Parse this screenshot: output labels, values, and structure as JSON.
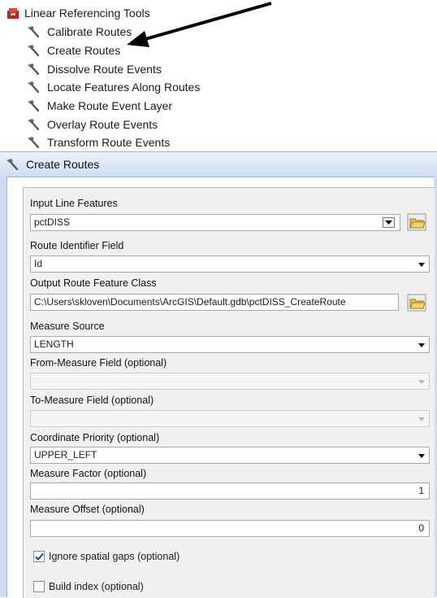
{
  "toolbox": {
    "name": "Linear Referencing Tools",
    "tools": [
      "Calibrate Routes",
      "Create Routes",
      "Dissolve Route Events",
      "Locate Features Along Routes",
      "Make Route Event Layer",
      "Overlay Route Events",
      "Transform Route Events"
    ]
  },
  "dialog": {
    "title": "Create Routes",
    "input_line_features": {
      "label": "Input Line Features",
      "value": "pctDISS"
    },
    "route_identifier_field": {
      "label": "Route Identifier Field",
      "value": "Id"
    },
    "output_route_feature_class": {
      "label": "Output Route Feature Class",
      "value": "C:\\Users\\skloven\\Documents\\ArcGIS\\Default.gdb\\pctDISS_CreateRoute"
    },
    "measure_source": {
      "label": "Measure Source",
      "value": "LENGTH"
    },
    "from_measure_field": {
      "label": "From-Measure Field (optional)",
      "value": ""
    },
    "to_measure_field": {
      "label": "To-Measure Field (optional)",
      "value": ""
    },
    "coordinate_priority": {
      "label": "Coordinate Priority (optional)",
      "value": "UPPER_LEFT"
    },
    "measure_factor": {
      "label": "Measure Factor (optional)",
      "value": "1"
    },
    "measure_offset": {
      "label": "Measure Offset (optional)",
      "value": "0"
    },
    "ignore_spatial_gaps": {
      "label": "Ignore spatial gaps (optional)",
      "checked": true
    },
    "build_index": {
      "label": "Build index (optional)",
      "checked": false
    }
  },
  "colors": {
    "titlebar": "#cfdff2",
    "panel": "#f0f0f0",
    "folder": "#e8c04a"
  }
}
